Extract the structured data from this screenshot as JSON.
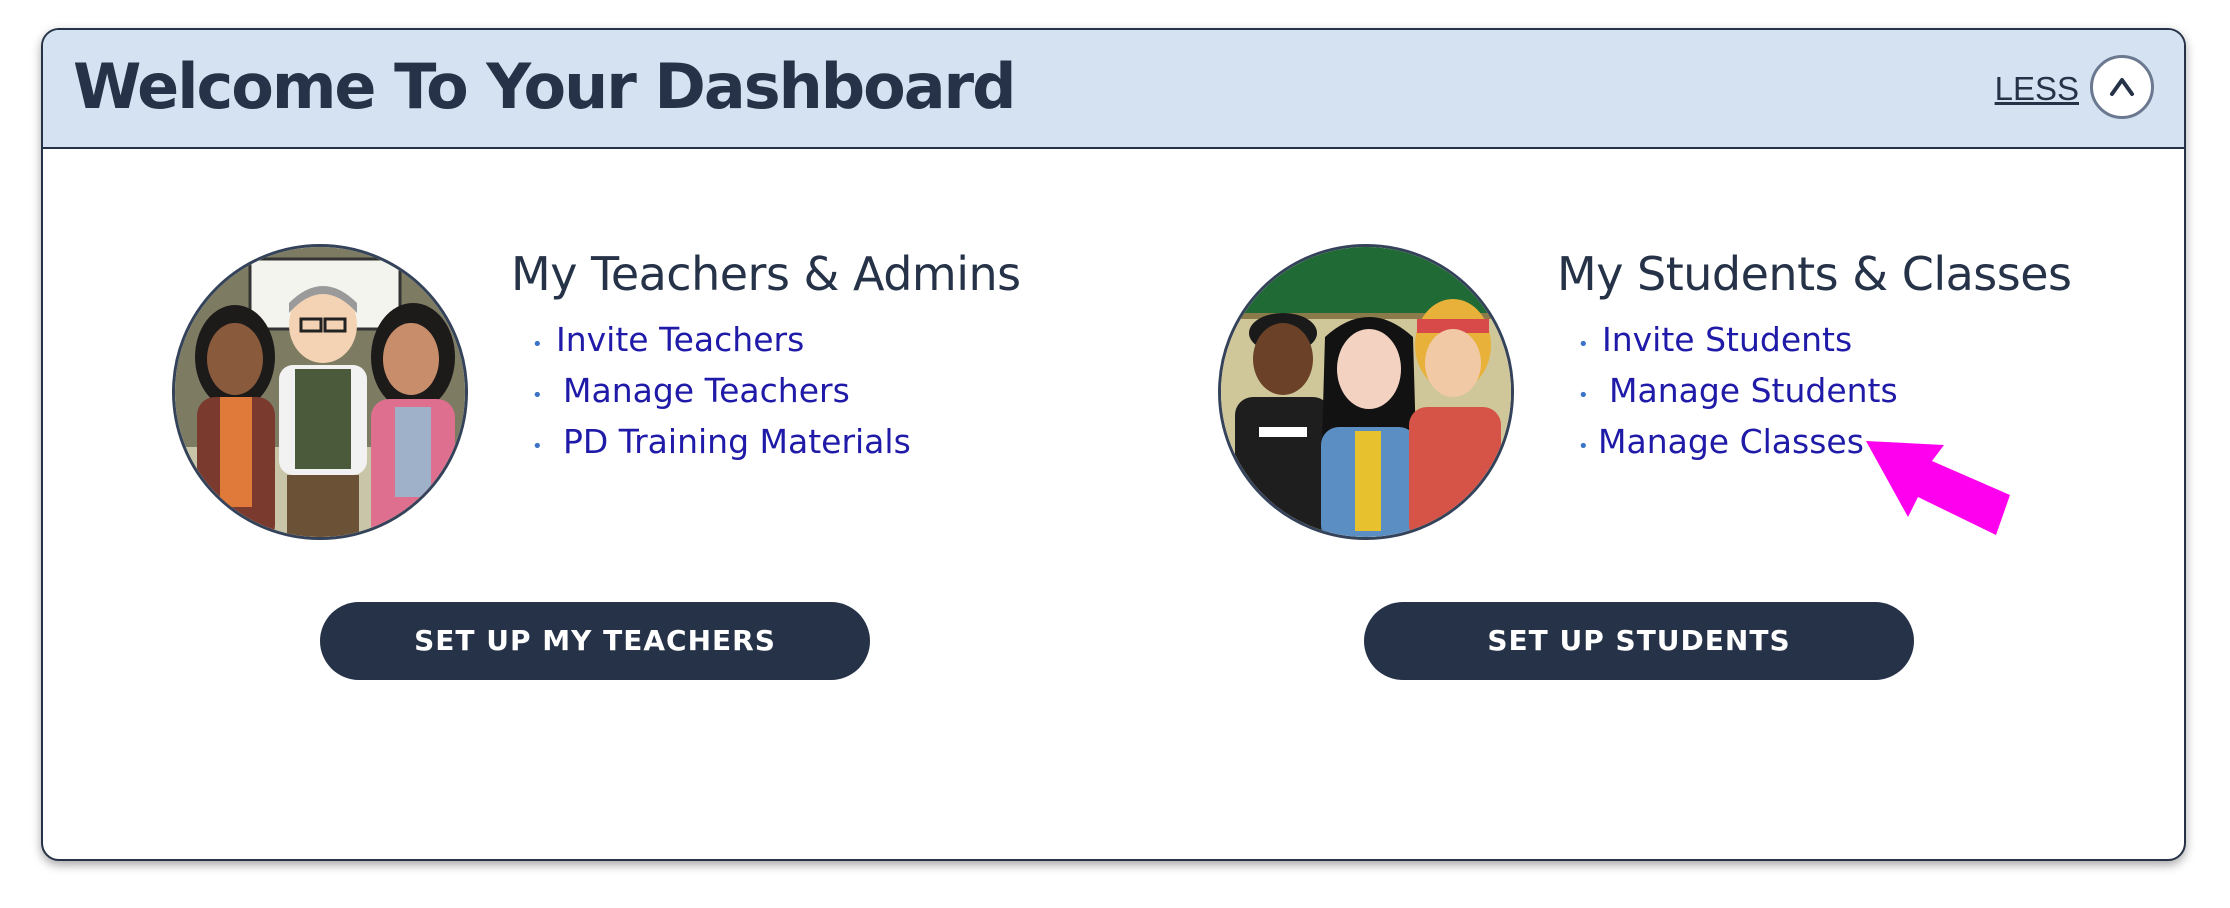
{
  "header": {
    "title": "Welcome To Your Dashboard",
    "toggle_label": "LESS"
  },
  "teachers": {
    "title": "My Teachers & Admins",
    "links": [
      "Invite Teachers",
      "Manage Teachers",
      "PD Training Materials"
    ],
    "button_label": "SET UP MY TEACHERS"
  },
  "students": {
    "title": "My Students & Classes",
    "links": [
      "Invite Students",
      "Manage Students",
      "Manage Classes"
    ],
    "button_label": "SET UP STUDENTS"
  },
  "icons": {
    "collapse": "chevron-up-icon",
    "bullet": "bullet-icon",
    "annotation": "pointer-arrow-icon"
  },
  "colors": {
    "header_bg": "#d4e2f2",
    "navy": "#253247",
    "link": "#1f1aa8",
    "annotation_arrow": "#ff00ee"
  }
}
